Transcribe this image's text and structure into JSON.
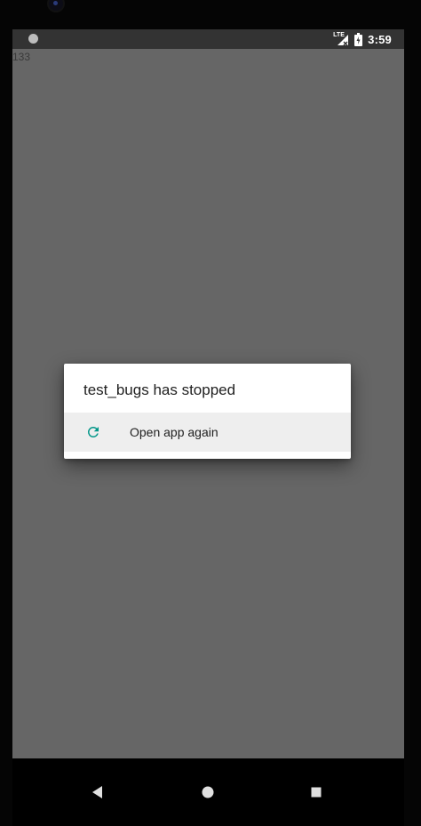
{
  "status_bar": {
    "network_label": "LTE",
    "time": "3:59"
  },
  "app": {
    "counter": "133"
  },
  "dialog": {
    "title": "test_bugs has stopped",
    "option_label": "Open app again"
  },
  "colors": {
    "accent": "#009688",
    "screen_bg": "#666666",
    "status_bg": "#333333",
    "dialog_option_bg": "#eeeeee"
  },
  "icons": {
    "reload": "reload-icon",
    "back": "back-triangle-icon",
    "home": "home-circle-icon",
    "recents": "recents-square-icon"
  }
}
